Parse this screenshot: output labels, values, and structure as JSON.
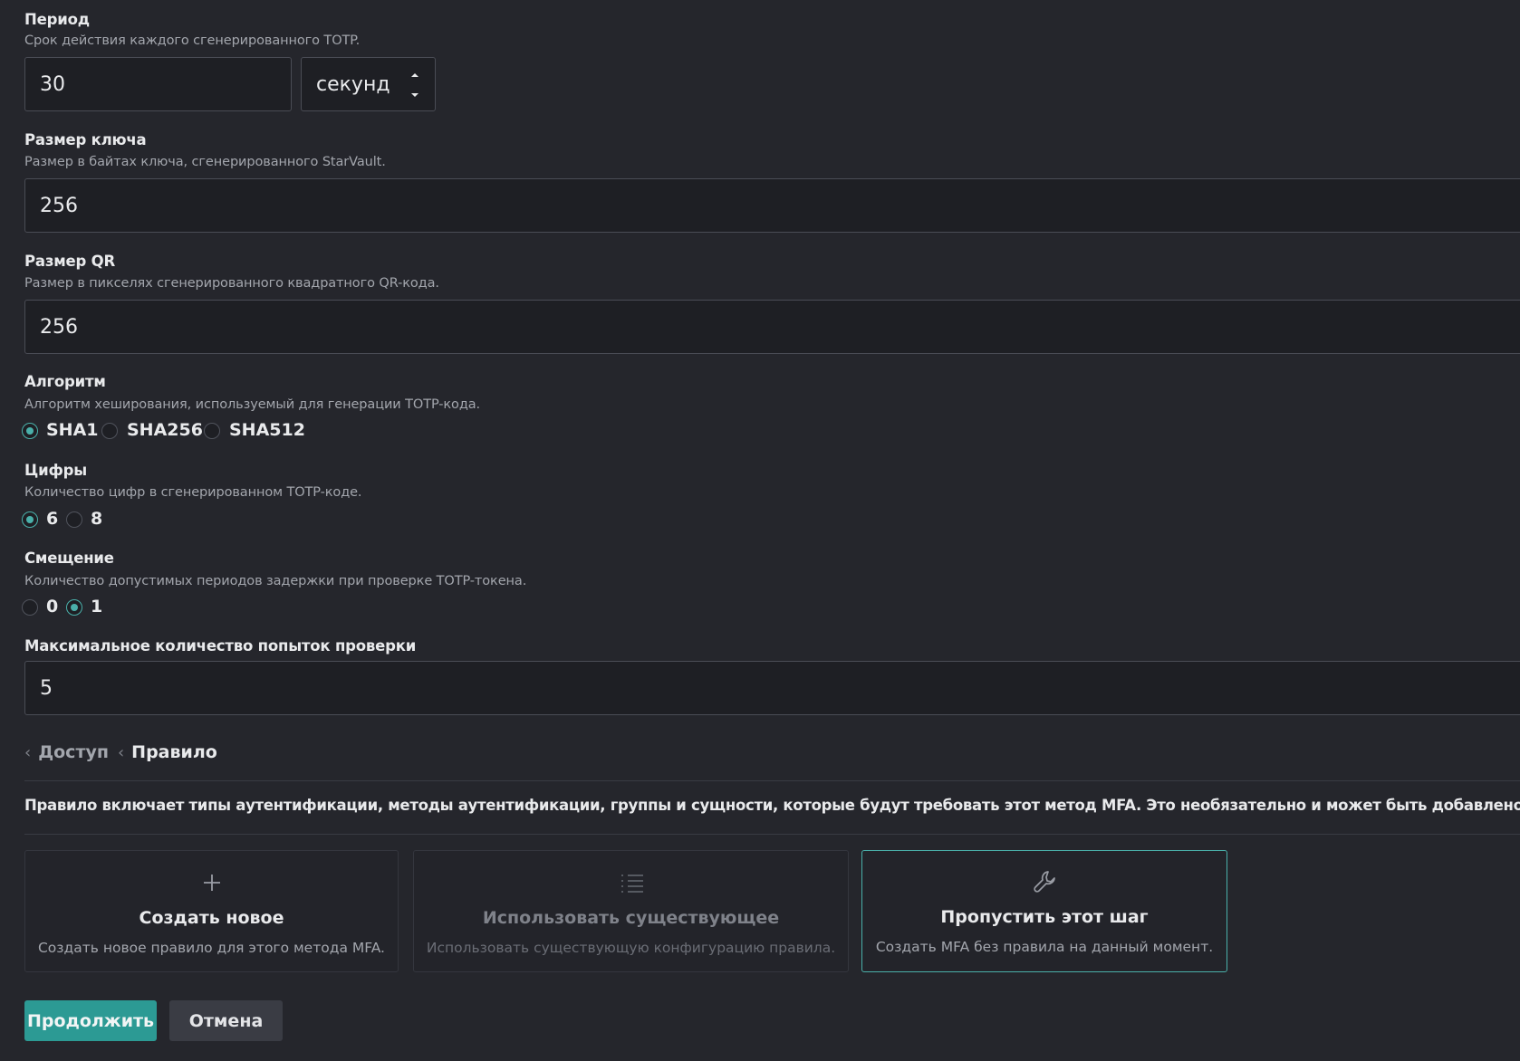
{
  "period": {
    "label": "Период",
    "description": "Срок действия каждого сгенерированного TOTP.",
    "value": "30",
    "unit": "секунд"
  },
  "key_size": {
    "label": "Размер ключа",
    "description": "Размер в байтах ключа, сгенерированного StarVault.",
    "value": "256"
  },
  "qr_size": {
    "label": "Размер QR",
    "description": "Размер в пикселях сгенерированного квадратного QR-кода.",
    "value": "256"
  },
  "algorithm": {
    "label": "Алгоритм",
    "description": "Алгоритм хеширования, используемый для генерации TOTP-кода.",
    "options": [
      "SHA1",
      "SHA256",
      "SHA512"
    ],
    "selected": "SHA1"
  },
  "digits": {
    "label": "Цифры",
    "description": "Количество цифр в сгенерированном TOTP-коде.",
    "options": [
      "6",
      "8"
    ],
    "selected": "6"
  },
  "skew": {
    "label": "Смещение",
    "description": "Количество допустимых периодов задержки при проверке TOTP-токена.",
    "options": [
      "0",
      "1"
    ],
    "selected": "1"
  },
  "max_attempts": {
    "label": "Максимальное количество попыток проверки",
    "value": "5"
  },
  "breadcrumb": {
    "items": [
      "Доступ",
      "Правило"
    ]
  },
  "rule_info": "Правило включает типы аутентификации, методы аутентификации, группы и сущности, которые будут требовать этот метод MFA. Это необязательно и может быть добавлено позже.",
  "rule_options": [
    {
      "title": "Создать новое",
      "description": "Создать новое правило для этого метода MFA.",
      "icon": "plus-icon",
      "state": "default"
    },
    {
      "title": "Использовать существующее",
      "description": "Использовать существующую конфигурацию правила.",
      "icon": "list-icon",
      "state": "disabled"
    },
    {
      "title": "Пропустить этот шаг",
      "description": "Создать MFA без правила на данный момент.",
      "icon": "wrench-icon",
      "state": "selected"
    }
  ],
  "actions": {
    "continue_label": "Продолжить",
    "cancel_label": "Отмена"
  },
  "colors": {
    "accent": "#4ab0aa",
    "background": "#25262c"
  }
}
